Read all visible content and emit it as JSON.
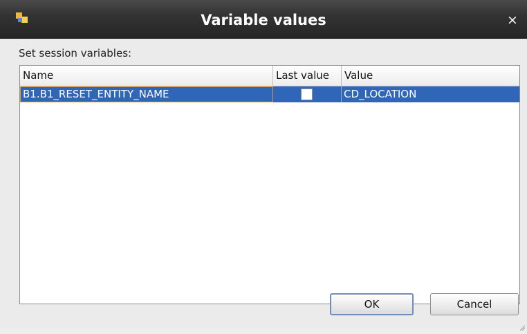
{
  "dialog": {
    "title": "Variable values",
    "close_glyph": "×"
  },
  "content": {
    "section_label": "Set session variables:"
  },
  "table": {
    "columns": {
      "name": "Name",
      "last_value": "Last value",
      "value": "Value"
    },
    "rows": [
      {
        "name": "B1.B1_RESET_ENTITY_NAME",
        "last_value_checked": false,
        "value": "CD_LOCATION",
        "selected": true
      }
    ]
  },
  "buttons": {
    "ok": "OK",
    "cancel": "Cancel"
  },
  "colors": {
    "titlebar": "#2f2f2f",
    "selection": "#2f66b7",
    "focus_border": "#e39a3a"
  },
  "icons": {
    "app": "oracle-odi-icon",
    "close": "close-icon",
    "resize": "resize-grip-icon"
  }
}
